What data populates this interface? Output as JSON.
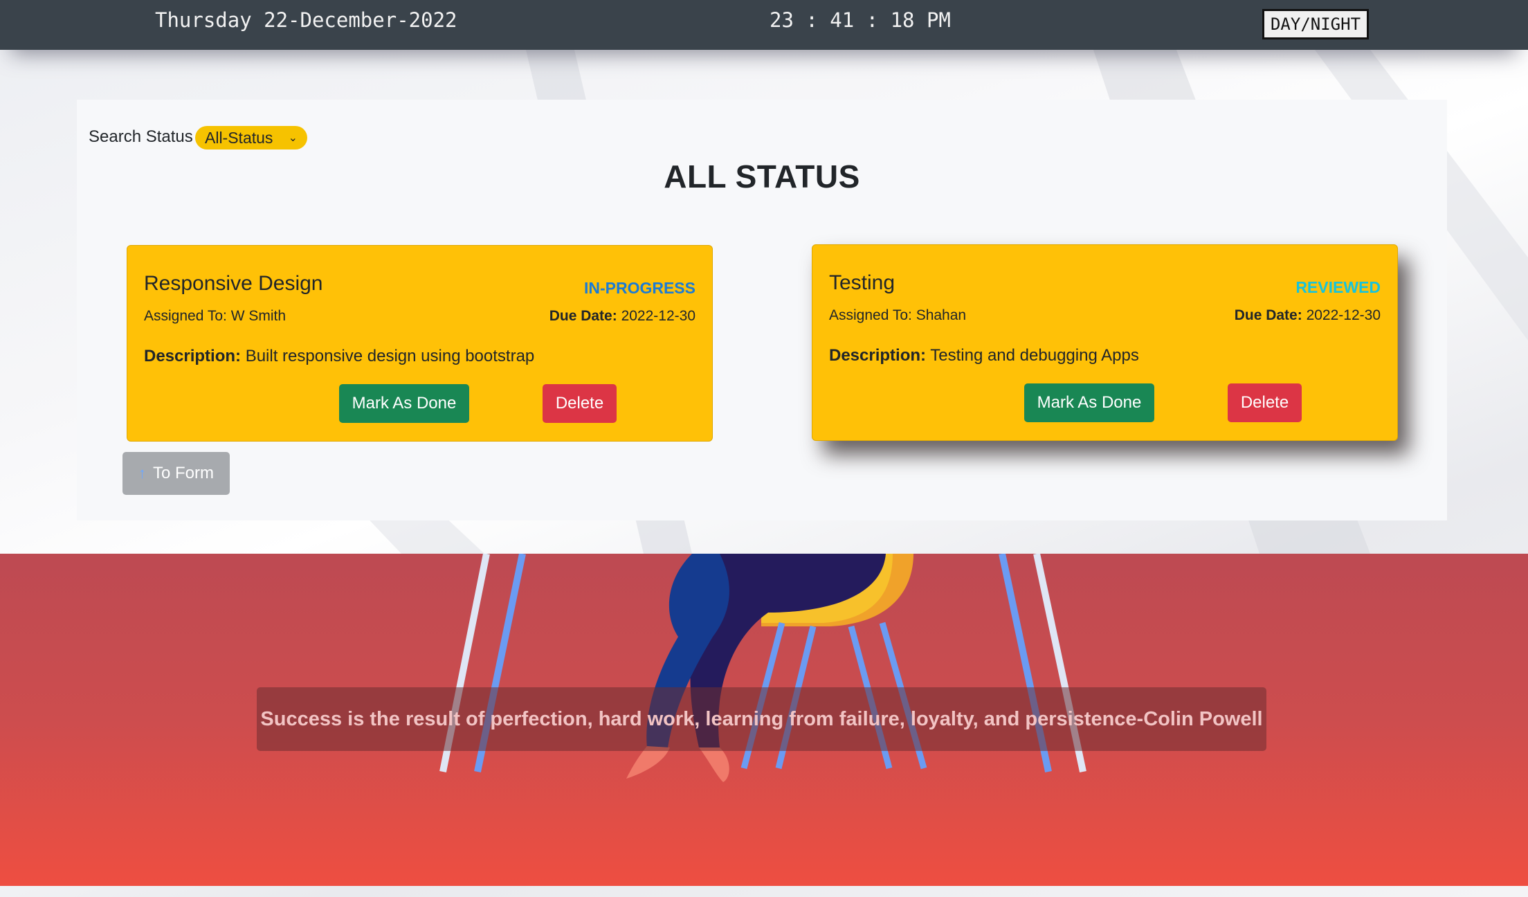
{
  "header": {
    "date": "Thursday 22-December-2022",
    "time": "23 : 41 : 18 PM",
    "toggle_label": "DAY/NIGHT"
  },
  "search": {
    "label": "Search Status",
    "selected": "All-Status"
  },
  "section_title": "ALL STATUS",
  "cards": [
    {
      "title": "Responsive Design",
      "status": "IN-PROGRESS",
      "status_color": "#1a7bd6",
      "assigned": "Assigned To: W Smith",
      "due_label": "Due Date:",
      "due_value": "2022-12-30",
      "desc_label": "Description:",
      "desc_value": "Built responsive design using bootstrap",
      "done_label": "Mark As Done",
      "delete_label": "Delete"
    },
    {
      "title": "Testing",
      "status": "REVIEWED",
      "status_color": "#17c3dc",
      "assigned": "Assigned To: Shahan",
      "due_label": "Due Date:",
      "due_value": "2022-12-30",
      "desc_label": "Description:",
      "desc_value": "Testing and debugging Apps",
      "done_label": "Mark As Done",
      "delete_label": "Delete"
    }
  ],
  "to_form": {
    "label": "To Form",
    "icon": "arrow-up-icon"
  },
  "footer": {
    "quote": "Success is the result of perfection, hard work, learning from failure, loyalty, and persistence-Colin Powell"
  },
  "colors": {
    "card": "#ffc107",
    "success": "#198754",
    "danger": "#dc3545",
    "topbar": "#3a434b"
  }
}
